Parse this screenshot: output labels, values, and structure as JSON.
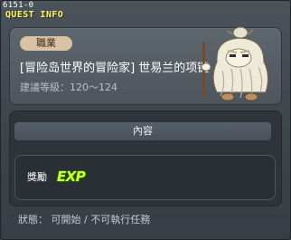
{
  "window": {
    "quest_id": "6151-0",
    "tag": "QUEST INFO"
  },
  "header": {
    "job_label": "職業",
    "title": "[冒险岛世界的冒险家] 世易兰的项链",
    "level": "建議等級：120〜124"
  },
  "content": {
    "section_label": "內容",
    "reward_label": "獎勵",
    "reward_icon": "exp-icon",
    "reward_icon_text": "EXP"
  },
  "status": {
    "text": "狀態： 可開始 / 不可執行任務"
  },
  "colors": {
    "tag": "#fff36b",
    "badge": "#d8c3a5",
    "exp": "#ccff33"
  }
}
